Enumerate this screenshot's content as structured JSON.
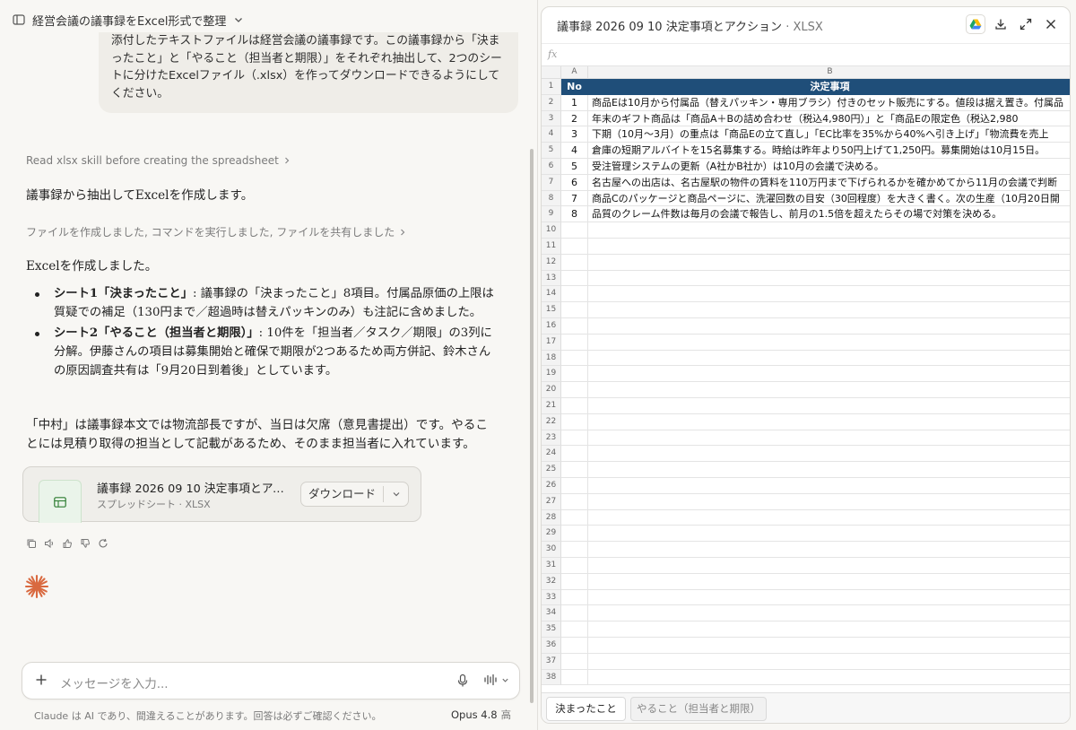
{
  "left": {
    "conversation_title": "経営会議の議事録をExcel形式で整理",
    "user_message": "添付したテキストファイルは経営会議の議事録です。この議事録から「決まったこと」と「やること（担当者と期限）」をそれぞれ抽出して、2つのシートに分けたExcelファイル（.xlsx）を作ってダウンロードできるようにしてください。",
    "skill_note": "Read xlsx skill before creating the spreadsheet",
    "reply_intro": "議事録から抽出してExcelを作成します。",
    "tool_summary": "ファイルを作成しました, コマンドを実行しました, ファイルを共有しました",
    "created_line": "Excelを作成しました。",
    "bullets": [
      {
        "bold": "シート1「決まったこと」",
        "text": ": 議事録の「決まったこと」8項目。付属品原価の上限は質疑での補足（130円まで／超過時は替えパッキンのみ）も注記に含めました。"
      },
      {
        "bold": "シート2「やること（担当者と期限）」",
        "text": ": 10件を「担当者／タスク／期限」の3列に分解。伊藤さんの項目は募集開始と確保で期限が2つあるため両方併記、鈴木さんの原因調査共有は「9月20日到着後」としています。"
      }
    ],
    "closing_note": "「中村」は議事録本文では物流部長ですが、当日は欠席（意見書提出）です。やることには見積り取得の担当として記載があるため、そのまま担当者に入れています。",
    "file_card": {
      "name": "議事録 2026 09 10 決定事項とアクション",
      "meta": "スプレッドシート · XLSX",
      "download_label": "ダウンロード"
    },
    "composer": {
      "placeholder": "メッセージを入力..."
    },
    "disclaimer": "Claude は AI であり、間違えることがあります。回答は必ずご確認ください。",
    "model_name": "Opus 4.8",
    "effort_label": "高"
  },
  "preview": {
    "title": "議事録 2026 09 10 決定事項とアクション",
    "title_sep": " · ",
    "file_type": "XLSX",
    "formula_label": "fx",
    "columns": [
      "A",
      "B"
    ],
    "header": {
      "no": "No",
      "decision": "決定事項"
    },
    "rows": [
      {
        "no": "1",
        "text": "商品Eは10月から付属品（替えパッキン・専用ブラシ）付きのセット販売にする。値段は据え置き。付属品"
      },
      {
        "no": "2",
        "text": "年末のギフト商品は「商品A＋Bの詰め合わせ（税込4,980円）」と「商品Eの限定色（税込2,980"
      },
      {
        "no": "3",
        "text": "下期（10月〜3月）の重点は「商品Eの立て直し」「EC比率を35%から40%へ引き上げ」「物流費を売上"
      },
      {
        "no": "4",
        "text": "倉庫の短期アルバイトを15名募集する。時給は昨年より50円上げて1,250円。募集開始は10月15日。"
      },
      {
        "no": "5",
        "text": "受注管理システムの更新（A社かB社か）は10月の会議で決める。"
      },
      {
        "no": "6",
        "text": "名古屋への出店は、名古屋駅の物件の賃料を110万円まで下げられるかを確かめてから11月の会議で判断"
      },
      {
        "no": "7",
        "text": "商品Cのパッケージと商品ページに、洗濯回数の目安（30回程度）を大きく書く。次の生産（10月20日開"
      },
      {
        "no": "8",
        "text": "品質のクレーム件数は毎月の会議で報告し、前月の1.5倍を超えたらその場で対策を決める。"
      }
    ],
    "row_count": 38,
    "sheets": [
      "決まったこと",
      "やること（担当者と期限）"
    ],
    "active_sheet": 0,
    "header_color": "#1f4e79"
  }
}
